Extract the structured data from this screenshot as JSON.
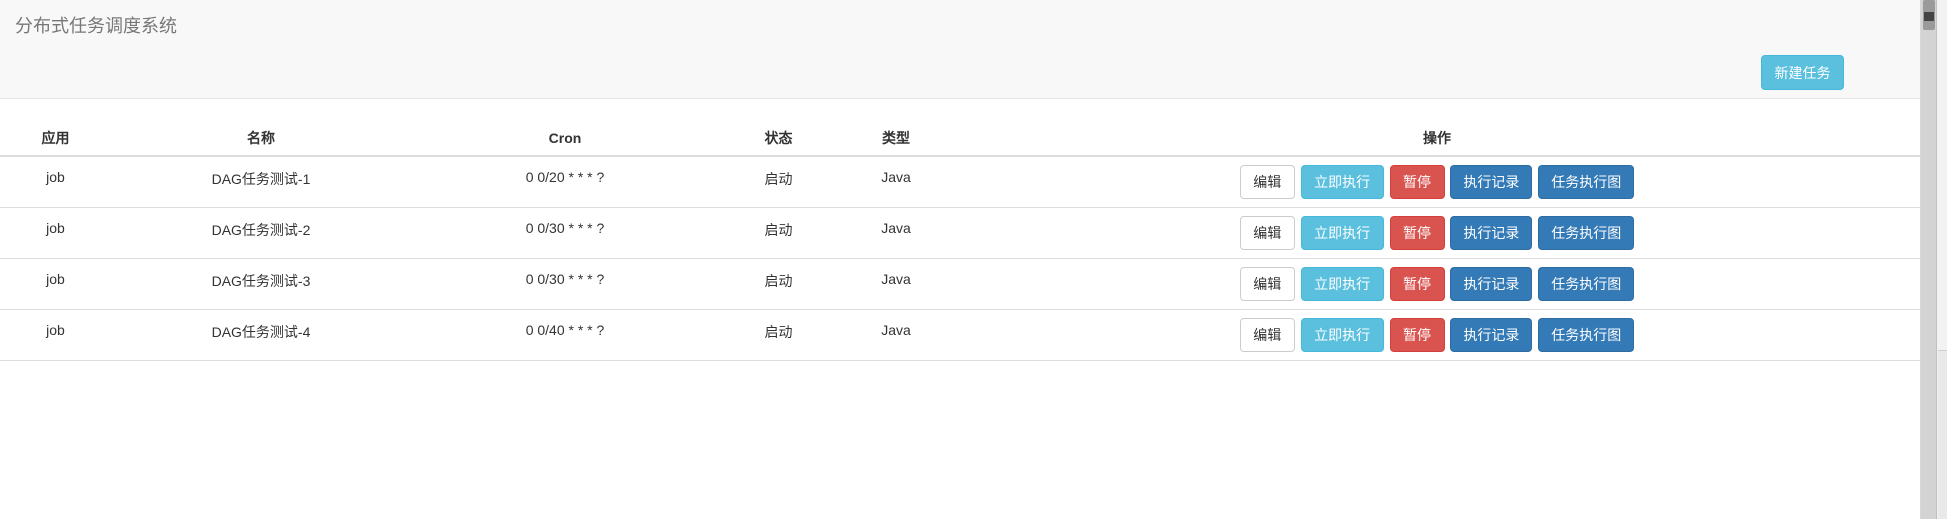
{
  "header": {
    "title": "分布式任务调度系统",
    "new_task_label": "新建任务"
  },
  "table": {
    "columns": [
      "应用",
      "名称",
      "Cron",
      "状态",
      "类型",
      "操作"
    ],
    "actions": {
      "edit": "编辑",
      "run_now": "立即执行",
      "pause": "暂停",
      "exec_log": "执行记录",
      "exec_graph": "任务执行图"
    },
    "rows": [
      {
        "app": "job",
        "name": "DAG任务测试-1",
        "cron": "0 0/20 * * * ?",
        "status": "启动",
        "type": "Java"
      },
      {
        "app": "job",
        "name": "DAG任务测试-2",
        "cron": "0 0/30 * * * ?",
        "status": "启动",
        "type": "Java"
      },
      {
        "app": "job",
        "name": "DAG任务测试-3",
        "cron": "0 0/30 * * * ?",
        "status": "启动",
        "type": "Java"
      },
      {
        "app": "job",
        "name": "DAG任务测试-4",
        "cron": "0 0/40 * * * ?",
        "status": "启动",
        "type": "Java"
      }
    ]
  },
  "colors": {
    "info": "#5bc0de",
    "danger": "#d9534f",
    "primary": "#337ab7"
  }
}
